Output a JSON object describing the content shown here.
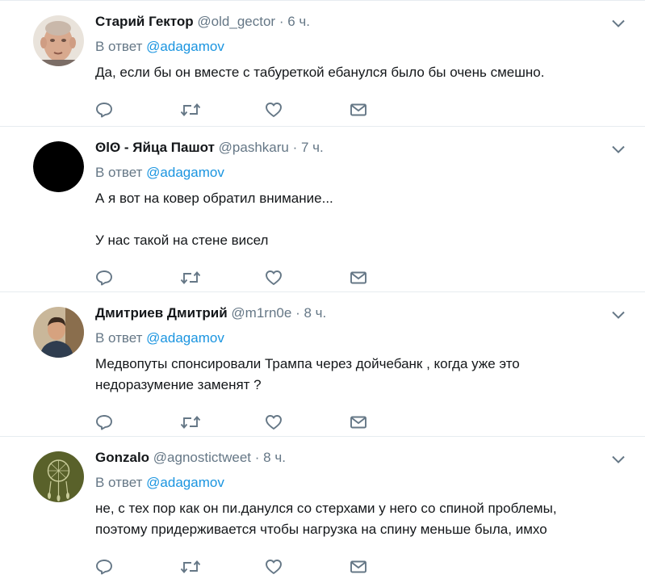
{
  "colors": {
    "text": "#14171a",
    "muted": "#657786",
    "link": "#1b95e0",
    "divider": "#e6ecf0"
  },
  "icons": {
    "reply": "reply-icon",
    "retweet": "retweet-icon",
    "like": "heart-icon",
    "dm": "envelope-icon",
    "more": "chevron-down-icon"
  },
  "tweets": [
    {
      "fullname": "Старий Гектор",
      "handle": "@old_gector",
      "dot": "·",
      "time": "6 ч.",
      "reply_prefix": "В ответ ",
      "reply_mention": "@adagamov",
      "text": [
        "Да, если бы он вместе с табуреткой ебанулся было бы очень смешно."
      ],
      "avatar": "photo-elderly-man"
    },
    {
      "fullname": "ʘlʘ - Яйца Пашот",
      "handle": "@pashkaru",
      "dot": "·",
      "time": "7 ч.",
      "reply_prefix": "В ответ ",
      "reply_mention": "@adagamov",
      "text": [
        "А я вот на ковер обратил внимание...",
        "У нас такой на стене висел"
      ],
      "avatar": "black-circle"
    },
    {
      "fullname": "Дмитриев Дмитрий",
      "handle": "@m1rn0e",
      "dot": "·",
      "time": "8 ч.",
      "reply_prefix": "В ответ ",
      "reply_mention": "@adagamov",
      "text": [
        "Медвопуты спонсировали Трампа через дойчебанк , когда уже это",
        "недоразумение заменят ?"
      ],
      "avatar": "photo-man-dark-shirt"
    },
    {
      "fullname": "Gonzalo",
      "handle": "@agnostictweet",
      "dot": "·",
      "time": "8 ч.",
      "reply_prefix": "В ответ ",
      "reply_mention": "@adagamov",
      "text": [
        "не, с тех пор как он пи.данулся со стерхами у него со спиной проблемы,",
        "поэтому придерживается чтобы нагрузка на спину меньше была, имхо"
      ],
      "avatar": "dreamcatcher-olive"
    }
  ]
}
